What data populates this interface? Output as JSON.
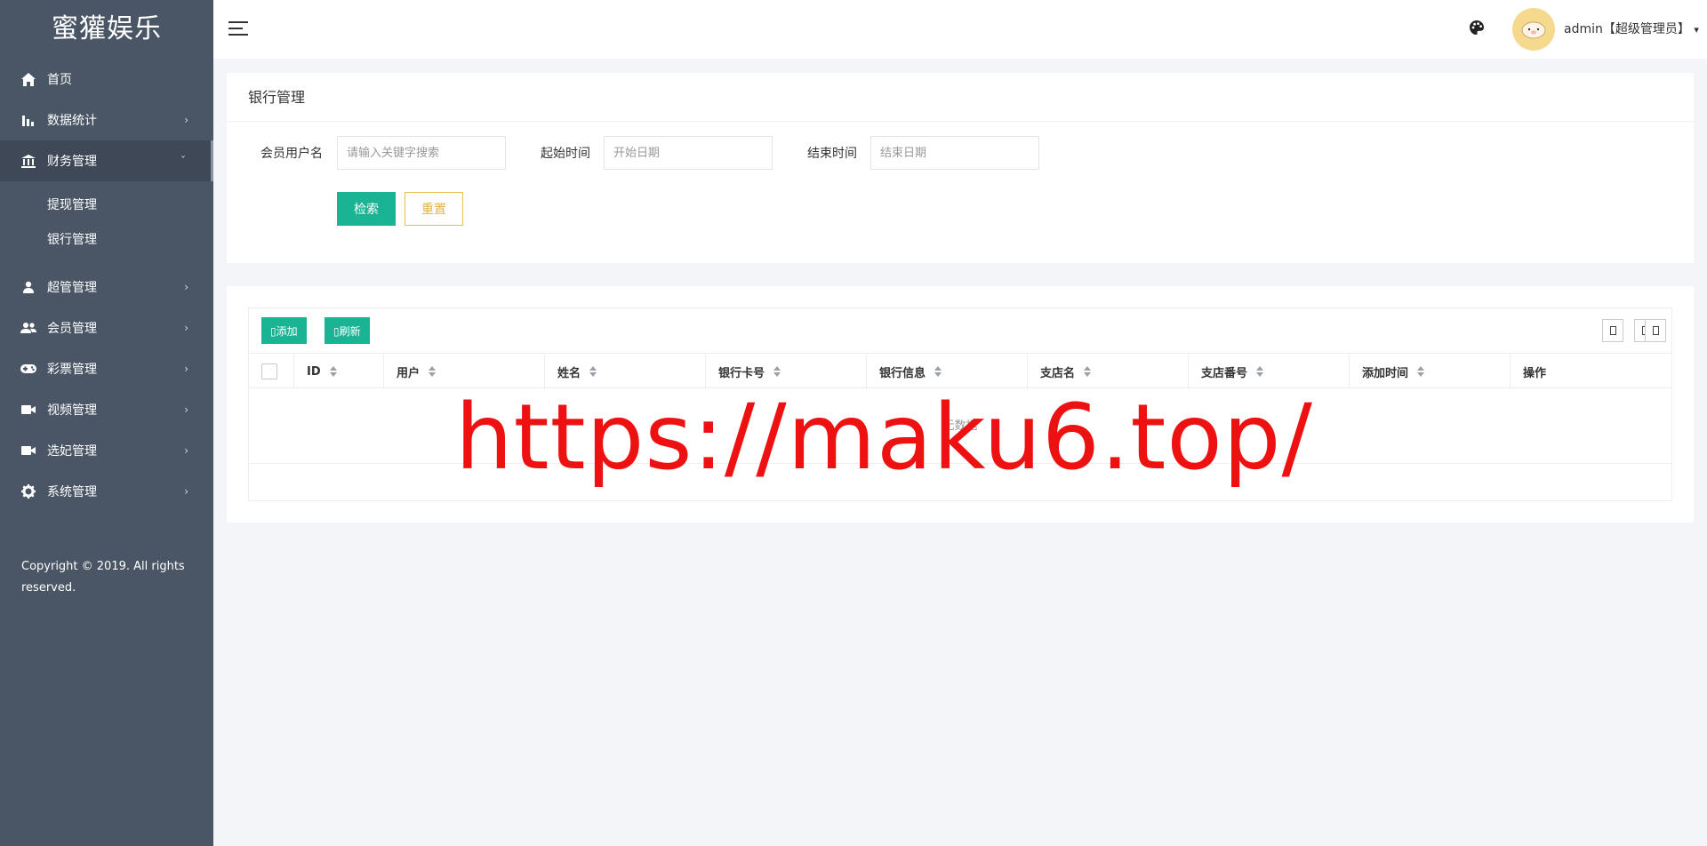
{
  "app": {
    "logo": "蜜獾娱乐"
  },
  "sidebar": {
    "items": [
      {
        "label": "首页",
        "icon": "home-icon"
      },
      {
        "label": "数据统计",
        "icon": "bar-chart-icon"
      },
      {
        "label": "财务管理",
        "icon": "bank-icon",
        "active": true,
        "children": [
          {
            "label": "提现管理"
          },
          {
            "label": "银行管理"
          }
        ]
      },
      {
        "label": "超管管理",
        "icon": "user-icon"
      },
      {
        "label": "会员管理",
        "icon": "users-icon"
      },
      {
        "label": "彩票管理",
        "icon": "gamepad-icon"
      },
      {
        "label": "视频管理",
        "icon": "video-icon"
      },
      {
        "label": "选妃管理",
        "icon": "video-icon"
      },
      {
        "label": "系统管理",
        "icon": "gear-icon"
      }
    ],
    "copyright": "Copyright © 2019. All rights reserved."
  },
  "header": {
    "user": "admin【超级管理员】",
    "dropdown_caret": "▾"
  },
  "search_card": {
    "title": "银行管理",
    "fields": [
      {
        "label": "会员用户名",
        "placeholder": "请输入关键字搜索"
      },
      {
        "label": "起始时间",
        "placeholder": "开始日期"
      },
      {
        "label": "结束时间",
        "placeholder": "结束日期"
      }
    ],
    "search_button": "检索",
    "reset_button": "重置"
  },
  "table_card": {
    "toolbar": {
      "add": "▯添加",
      "refresh": "▯刷新"
    },
    "columns": [
      "ID",
      "用户",
      "姓名",
      "银行卡号",
      "银行信息",
      "支店名",
      "支店番号",
      "添加时间",
      "操作"
    ],
    "empty_text": "无数据"
  },
  "watermark": "https://maku6.top/",
  "colors": {
    "sidebar": "#4a5565",
    "primary": "#1ab394",
    "warning": "#e8c24c",
    "watermark": "#ee1111"
  }
}
